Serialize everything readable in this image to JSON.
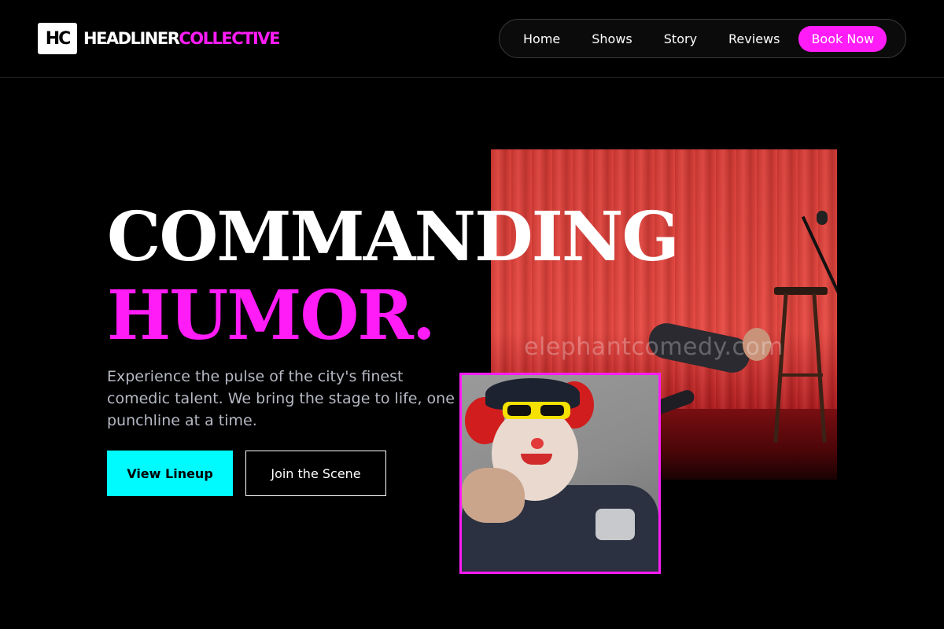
{
  "brand": {
    "badge": "HC",
    "name_part1": "HEADLINER",
    "name_part2": "COLLECTIVE",
    "accent_color": "#ff1cf7"
  },
  "nav": {
    "items": [
      {
        "label": "Home"
      },
      {
        "label": "Shows"
      },
      {
        "label": "Story"
      },
      {
        "label": "Reviews"
      }
    ],
    "cta_label": "Book Now"
  },
  "hero": {
    "headline_line1": "COMMANDING",
    "headline_line2": "HUMOR.",
    "subtext": "Experience the pulse of the city's finest comedic talent. We bring the stage to life, one punchline at a time.",
    "primary_button": "View Lineup",
    "secondary_button": "Join the Scene",
    "primary_color": "#00fbff"
  },
  "images": {
    "main_watermark": "elephantcomedy.com",
    "main_alt": "comedian performing on stage in front of red curtain",
    "inset_alt": "clown in police uniform pointing"
  }
}
